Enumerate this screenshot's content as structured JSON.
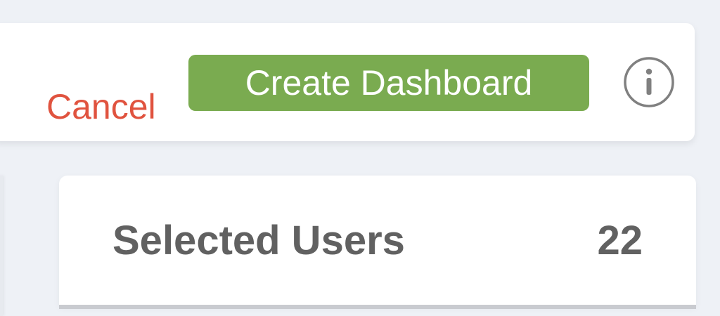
{
  "toolbar": {
    "cancel_label": "Cancel",
    "create_label": "Create Dashboard",
    "info_icon": "info-icon"
  },
  "selected_users": {
    "label": "Selected Users",
    "count": "22"
  },
  "colors": {
    "background": "#eef1f6",
    "cancel_text": "#e0533f",
    "primary_button": "#7aab50",
    "icon_gray": "#808080",
    "label_text": "#616161"
  }
}
